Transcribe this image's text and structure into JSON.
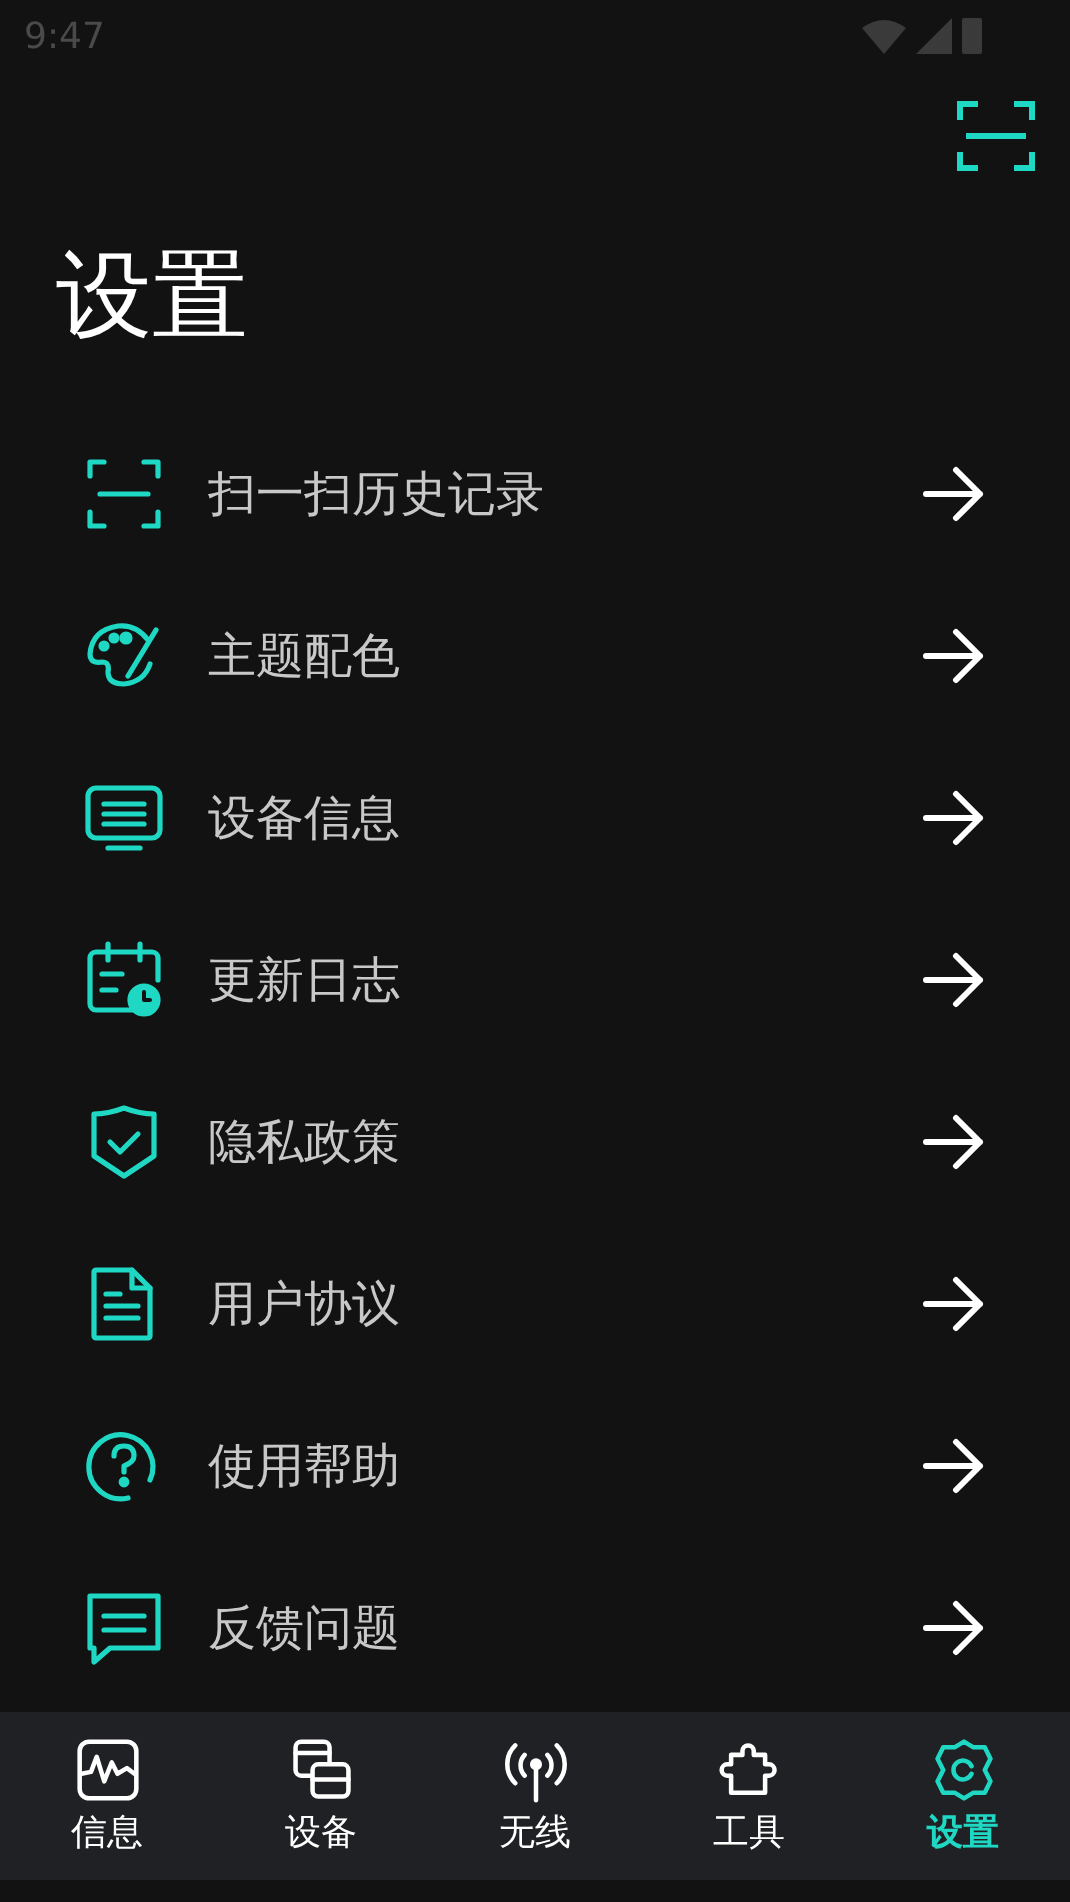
{
  "status_bar": {
    "time": "9:47"
  },
  "title": "设置",
  "items": [
    {
      "label": "扫一扫历史记录"
    },
    {
      "label": "主题配色"
    },
    {
      "label": "设备信息"
    },
    {
      "label": "更新日志"
    },
    {
      "label": "隐私政策"
    },
    {
      "label": "用户协议"
    },
    {
      "label": "使用帮助"
    },
    {
      "label": "反馈问题"
    }
  ],
  "nav": [
    {
      "label": "信息",
      "selected": false
    },
    {
      "label": "设备",
      "selected": false
    },
    {
      "label": "无线",
      "selected": false
    },
    {
      "label": "工具",
      "selected": false
    },
    {
      "label": "设置",
      "selected": true
    }
  ]
}
